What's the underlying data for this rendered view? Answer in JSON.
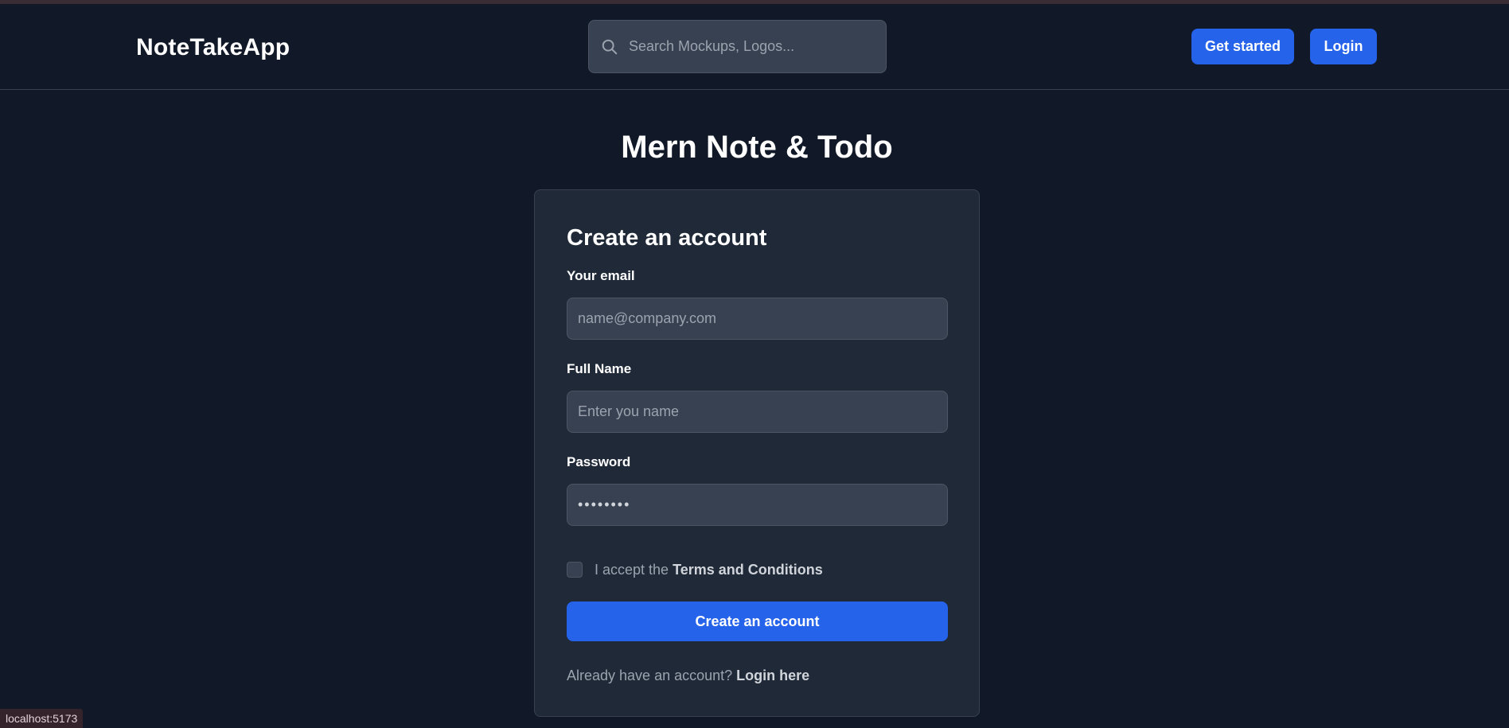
{
  "header": {
    "brand": "NoteTakeApp",
    "search": {
      "placeholder": "Search Mockups, Logos...",
      "value": ""
    },
    "get_started_label": "Get started",
    "login_label": "Login"
  },
  "main": {
    "page_title": "Mern Note & Todo"
  },
  "form": {
    "title": "Create an account",
    "email": {
      "label": "Your email",
      "placeholder": "name@company.com",
      "value": ""
    },
    "full_name": {
      "label": "Full Name",
      "placeholder": "Enter you name",
      "value": ""
    },
    "password": {
      "label": "Password",
      "value": "••••••••"
    },
    "terms": {
      "checked": false,
      "prefix": "I accept the",
      "link": "Terms and Conditions"
    },
    "submit_label": "Create an account",
    "login_prompt": {
      "text": "Already have an account?",
      "link": "Login here"
    }
  },
  "status_bar": {
    "url": "localhost:5173"
  },
  "colors": {
    "background": "#111827",
    "card": "#1f2937",
    "input": "#374151",
    "accent": "#2563eb"
  },
  "icons": {
    "search": "search-icon"
  }
}
